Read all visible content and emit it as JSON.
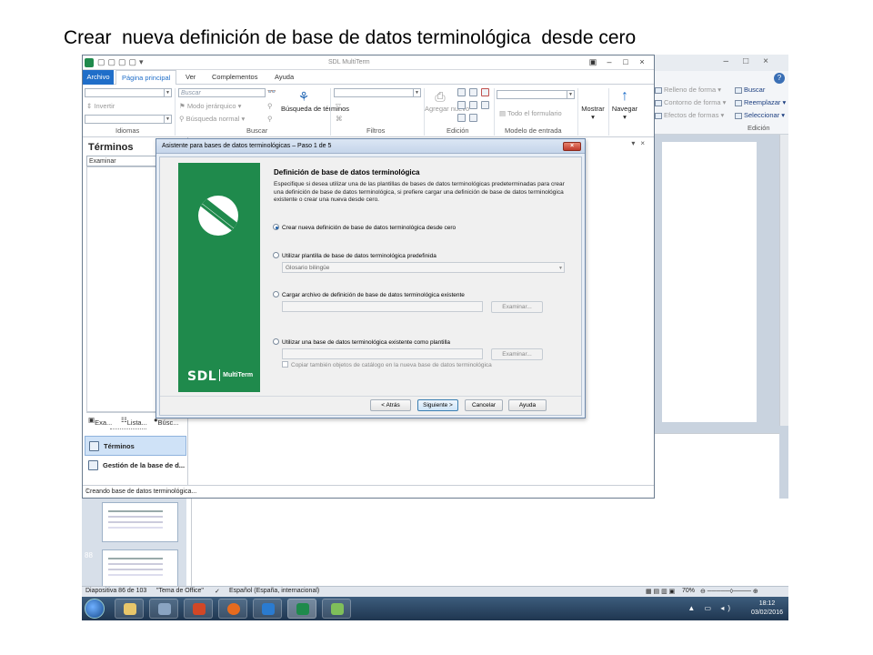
{
  "slide": {
    "title": "Crear  nueva definición de base de datos terminológica  desde cero"
  },
  "multiterm": {
    "app_title": "SDL MultiTerm",
    "tabs": [
      "Archivo",
      "Página principal",
      "Ver",
      "Complementos",
      "Ayuda"
    ],
    "ribbon": {
      "search_placeholder": "Buscar",
      "invert": "Invertir",
      "hier_mode": "Modo jerárquico",
      "normal_search": "Búsqueda normal",
      "term_search": "Búsqueda de términos",
      "add_new": "Agregar nuevo",
      "full_form": "Todo el formulario",
      "show": "Mostrar",
      "navigate": "Navegar",
      "groups": [
        "Idiomas",
        "Buscar",
        "Filtros",
        "Edición",
        "Modelo de entrada"
      ]
    },
    "pane": {
      "title": "Términos",
      "search_value": "Examinar",
      "tab_browse": "Exa...",
      "tab_list": "Lista...",
      "tab_other": "Búsc...",
      "nav_terms": "Términos",
      "nav_db": "Gestión de la base de d..."
    },
    "status": "Creando base de datos terminológica..."
  },
  "wizard": {
    "title": "Asistente para bases de datos terminológicas – Paso 1 de 5",
    "heading": "Definición de base de datos terminológica",
    "description": "Especifique si desea utilizar una de las plantillas de bases de datos terminológicas predeterminadas para crear una definición de base de datos terminológica, si prefiere cargar una definición de base de datos terminológica existente o crear una nueva desde cero.",
    "option_new": "Crear nueva definición de base de datos terminológica desde cero",
    "option_template": "Utilizar plantilla de base de datos terminológica predefinida",
    "template_value": "Glosario bilingüe",
    "option_load": "Cargar archivo de definición de base de datos terminológica existente",
    "option_existing": "Utilizar una base de datos terminológica existente como plantilla",
    "browse": "Examinar...",
    "copy_catalog": "Copiar también objetos de catálogo en la nueva base de datos terminológica",
    "btn_back": "< Atrás",
    "btn_next": "Siguiente >",
    "btn_cancel": "Cancelar",
    "btn_help": "Ayuda",
    "brand": "SDL",
    "brand_product": "MultiTerm"
  },
  "powerpoint": {
    "fill": "Relleno de forma",
    "outline": "Contorno de forma",
    "effects": "Efectos de formas",
    "find": "Buscar",
    "replace": "Reemplazar",
    "select": "Seleccionar",
    "group": "Edición",
    "thumb_num": "88",
    "status_slide": "Diapositiva 86 de 103",
    "status_theme": "\"Tema de Office\"",
    "status_lang": "Español (España, internacional)",
    "zoom": "70%"
  },
  "taskbar": {
    "time": "18:12",
    "date": "03/02/2016"
  }
}
